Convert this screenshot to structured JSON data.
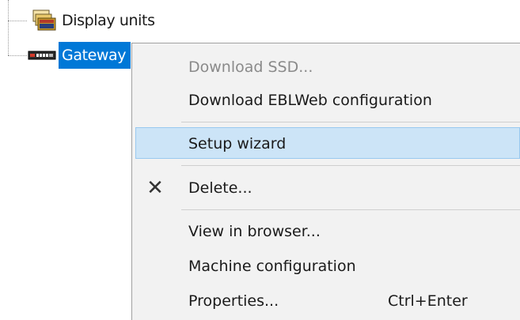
{
  "tree": {
    "items": [
      {
        "label": "Display units",
        "icon": "display-units-icon",
        "selected": false
      },
      {
        "label": "Gateway",
        "icon": "gateway-device-icon",
        "selected": true
      }
    ]
  },
  "context_menu": {
    "items": [
      {
        "label": "Download SSD...",
        "disabled": true
      },
      {
        "label": "Download EBLWeb configuration",
        "disabled": false
      },
      {
        "label": "Setup wizard",
        "highlighted": true
      },
      {
        "label": "Delete...",
        "icon": "delete-x-icon",
        "glyph": "✕"
      },
      {
        "label": "View in browser..."
      },
      {
        "label": "Machine configuration"
      },
      {
        "label": "Properties...",
        "shortcut": "Ctrl+Enter"
      }
    ]
  },
  "colors": {
    "selection_blue": "#0078d7",
    "menu_background": "#f2f2f2",
    "menu_highlight": "#cce4f7",
    "menu_highlight_border": "#99c9ef",
    "disabled_text": "#8a8a8a"
  }
}
